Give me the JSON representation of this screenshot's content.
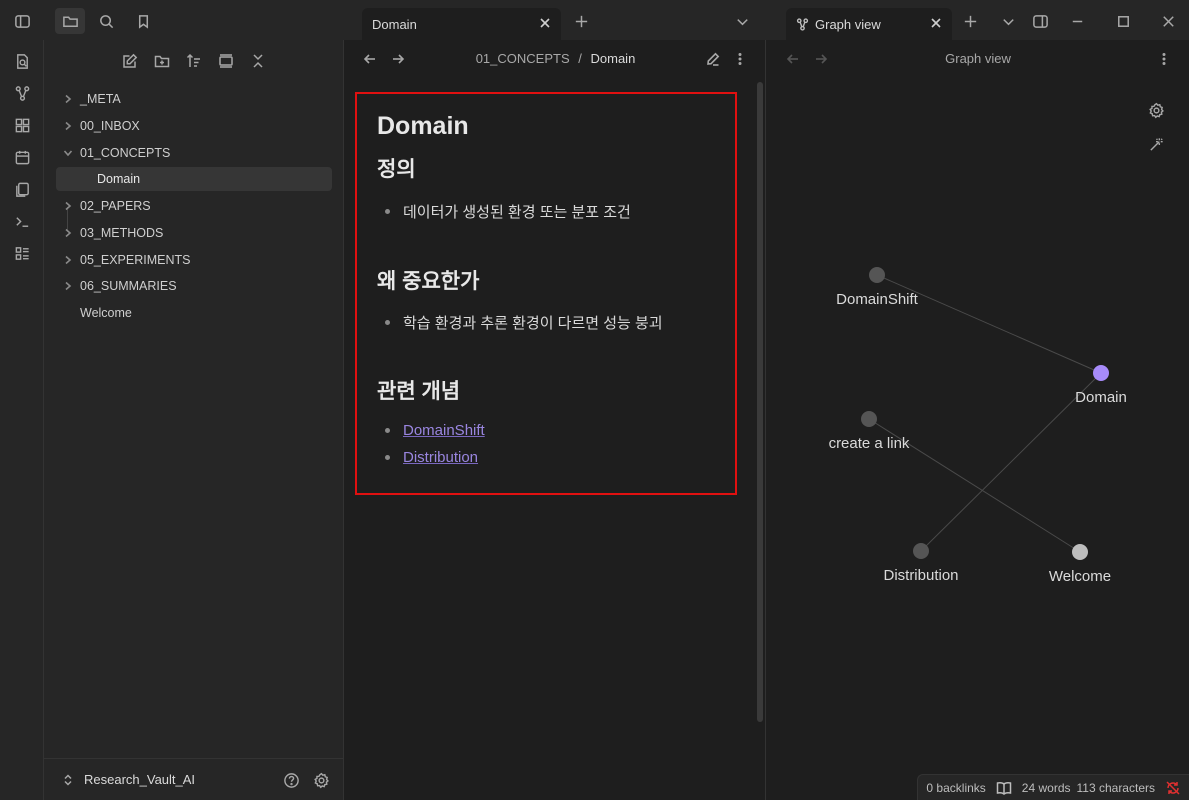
{
  "titlebar": {
    "tabs": [
      {
        "label": "Domain"
      },
      {
        "label": "Graph view"
      }
    ]
  },
  "sidebar": {
    "tree": [
      {
        "label": "_META",
        "type": "folder",
        "expanded": false
      },
      {
        "label": "00_INBOX",
        "type": "folder",
        "expanded": false
      },
      {
        "label": "01_CONCEPTS",
        "type": "folder",
        "expanded": true
      },
      {
        "label": "Domain",
        "type": "file",
        "selected": true
      },
      {
        "label": "02_PAPERS",
        "type": "folder",
        "expanded": false
      },
      {
        "label": "03_METHODS",
        "type": "folder",
        "expanded": false
      },
      {
        "label": "05_EXPERIMENTS",
        "type": "folder",
        "expanded": false
      },
      {
        "label": "06_SUMMARIES",
        "type": "folder",
        "expanded": false
      },
      {
        "label": "Welcome",
        "type": "file",
        "selected": false
      }
    ],
    "vault_name": "Research_Vault_AI"
  },
  "editor": {
    "breadcrumb": {
      "folder": "01_CONCEPTS",
      "separator": "/",
      "file": "Domain"
    },
    "note": {
      "title": "Domain",
      "sections": [
        {
          "heading": "정의",
          "items": [
            "데이터가 생성된 환경 또는 분포 조건"
          ]
        },
        {
          "heading": "왜 중요한가",
          "items": [
            "학습 환경과 추론 환경이 다르면 성능 붕괴"
          ]
        },
        {
          "heading": "관련 개념",
          "links": [
            "DomainShift",
            "Distribution"
          ]
        }
      ]
    }
  },
  "graph": {
    "title": "Graph view",
    "nodes": [
      {
        "label": "DomainShift",
        "color": "#555555"
      },
      {
        "label": "Domain",
        "color": "#a78bfa"
      },
      {
        "label": "create a link",
        "color": "#555555"
      },
      {
        "label": "Distribution",
        "color": "#555555"
      },
      {
        "label": "Welcome",
        "color": "#bdbdbd"
      }
    ],
    "edges": [
      [
        "DomainShift",
        "Domain"
      ],
      [
        "Domain",
        "Distribution"
      ],
      [
        "create a link",
        "Welcome"
      ]
    ]
  },
  "status_bar": {
    "backlinks": "0 backlinks",
    "words": "24 words",
    "characters": "113 characters"
  },
  "colors": {
    "accent": "#a78bfa",
    "link": "#9a86e0",
    "highlight_border": "#e01010",
    "sync_error": "#e03030"
  }
}
